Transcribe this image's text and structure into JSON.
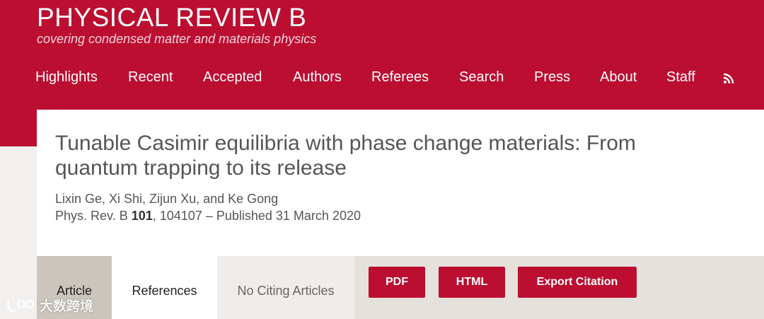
{
  "journal": {
    "title": "PHYSICAL REVIEW B",
    "subtitle": "covering condensed matter and materials physics",
    "brand_color": "#bb0e31"
  },
  "nav": {
    "items": [
      "Highlights",
      "Recent",
      "Accepted",
      "Authors",
      "Referees",
      "Search",
      "Press",
      "About",
      "Staff"
    ],
    "rss_icon": "rss-icon"
  },
  "article": {
    "title_line1": "Tunable Casimir equilibria with phase change materials: From",
    "title_line2": "quantum trapping to its release",
    "authors": "Lixin Ge, Xi Shi, Zijun Xu, and Ke Gong",
    "journal_abbrev": "Phys. Rev. B",
    "volume": "101",
    "citation_rest": ", 104107 – Published 31 March 2020"
  },
  "tabs": {
    "article": "Article",
    "references": "References",
    "citing": "No Citing Articles"
  },
  "buttons": {
    "pdf": "PDF",
    "html": "HTML",
    "export": "Export Citation"
  },
  "watermark": {
    "text": "大数跨境",
    "icon": "watermark-logo-icon"
  }
}
